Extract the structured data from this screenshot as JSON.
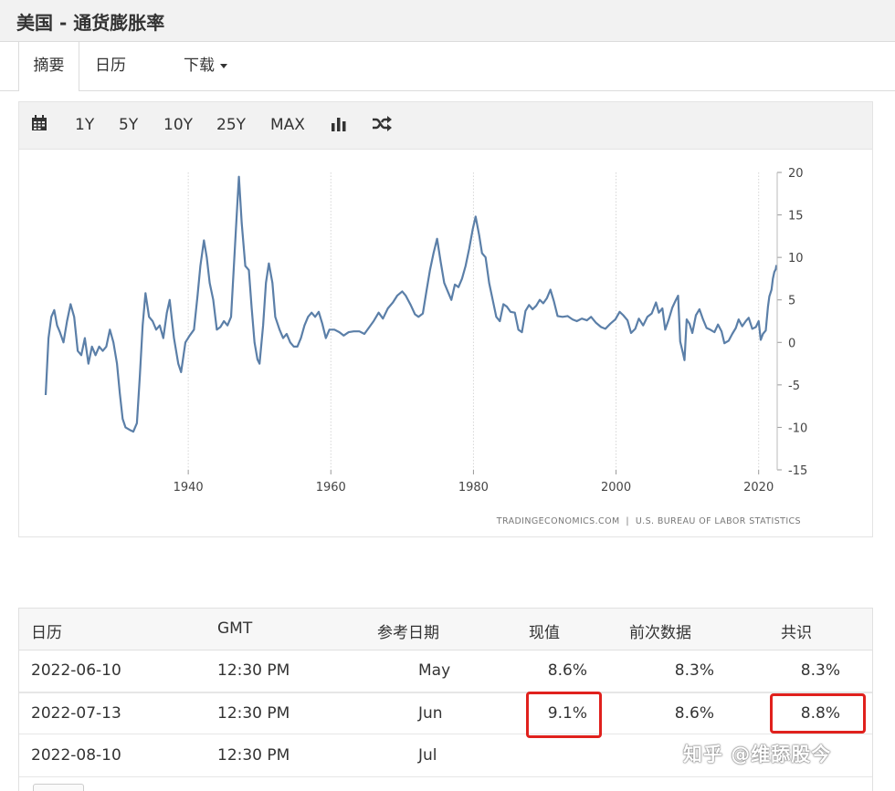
{
  "page": {
    "title": "美国 - 通货膨胀率"
  },
  "tabs": [
    {
      "label": "摘要",
      "active": true
    },
    {
      "label": "日历",
      "active": false
    },
    {
      "label": "下载",
      "active": false
    }
  ],
  "toolbar": {
    "icons": [
      "calendar-icon",
      "bar-chart-icon",
      "shuffle-icon"
    ],
    "ranges": [
      "1Y",
      "5Y",
      "10Y",
      "25Y",
      "MAX"
    ]
  },
  "chart": {
    "source": "TRADINGECONOMICS.COM  |  U.S. BUREAU OF LABOR STATISTICS",
    "line_color": "#5b7fa8"
  },
  "chart_data": {
    "type": "line",
    "title": "",
    "xlabel": "",
    "ylabel": "",
    "xlim": [
      1920,
      2022.6
    ],
    "ylim": [
      -15,
      20
    ],
    "xticks": [
      1940,
      1960,
      1980,
      2000,
      2020
    ],
    "yticks": [
      20,
      15,
      10,
      5,
      0,
      -5,
      -10,
      -15
    ],
    "grid": true,
    "series": [
      {
        "name": "",
        "points": [
          [
            1920.0,
            -6.2
          ],
          [
            1920.4,
            0.5
          ],
          [
            1920.8,
            3.0
          ],
          [
            1921.2,
            3.8
          ],
          [
            1921.6,
            2.0
          ],
          [
            1922.0,
            1.2
          ],
          [
            1922.5,
            0.0
          ],
          [
            1923.0,
            2.5
          ],
          [
            1923.5,
            4.5
          ],
          [
            1924.0,
            3.0
          ],
          [
            1924.5,
            -1.0
          ],
          [
            1925.0,
            -1.5
          ],
          [
            1925.5,
            0.5
          ],
          [
            1926.0,
            -2.5
          ],
          [
            1926.5,
            -0.5
          ],
          [
            1927.0,
            -1.5
          ],
          [
            1927.5,
            -0.5
          ],
          [
            1928.0,
            -1.0
          ],
          [
            1928.5,
            -0.5
          ],
          [
            1929.0,
            1.5
          ],
          [
            1929.5,
            0.0
          ],
          [
            1930.0,
            -2.5
          ],
          [
            1930.4,
            -6.0
          ],
          [
            1930.8,
            -9.0
          ],
          [
            1931.2,
            -10.0
          ],
          [
            1931.8,
            -10.3
          ],
          [
            1932.3,
            -10.5
          ],
          [
            1932.8,
            -9.5
          ],
          [
            1933.2,
            -4.0
          ],
          [
            1933.6,
            2.0
          ],
          [
            1934.0,
            5.8
          ],
          [
            1934.5,
            3.0
          ],
          [
            1935.0,
            2.5
          ],
          [
            1935.5,
            1.5
          ],
          [
            1936.0,
            2.0
          ],
          [
            1936.5,
            0.5
          ],
          [
            1937.0,
            3.5
          ],
          [
            1937.4,
            5.0
          ],
          [
            1938.0,
            0.5
          ],
          [
            1938.6,
            -2.5
          ],
          [
            1939.0,
            -3.5
          ],
          [
            1939.6,
            0.0
          ],
          [
            1940.2,
            0.8
          ],
          [
            1940.8,
            1.5
          ],
          [
            1941.3,
            5.5
          ],
          [
            1941.7,
            9.0
          ],
          [
            1942.2,
            12.0
          ],
          [
            1942.6,
            10.0
          ],
          [
            1943.0,
            7.0
          ],
          [
            1943.5,
            5.0
          ],
          [
            1944.0,
            1.5
          ],
          [
            1944.5,
            1.8
          ],
          [
            1945.0,
            2.5
          ],
          [
            1945.5,
            2.0
          ],
          [
            1946.0,
            3.0
          ],
          [
            1946.4,
            9.0
          ],
          [
            1946.8,
            15.0
          ],
          [
            1947.1,
            19.5
          ],
          [
            1947.5,
            14.0
          ],
          [
            1948.0,
            9.0
          ],
          [
            1948.5,
            8.5
          ],
          [
            1948.9,
            4.0
          ],
          [
            1949.3,
            0.0
          ],
          [
            1949.7,
            -2.0
          ],
          [
            1950.0,
            -2.5
          ],
          [
            1950.5,
            2.0
          ],
          [
            1950.9,
            7.0
          ],
          [
            1951.3,
            9.3
          ],
          [
            1951.8,
            7.0
          ],
          [
            1952.2,
            3.0
          ],
          [
            1952.8,
            1.5
          ],
          [
            1953.3,
            0.5
          ],
          [
            1953.8,
            1.0
          ],
          [
            1954.3,
            0.0
          ],
          [
            1954.8,
            -0.5
          ],
          [
            1955.3,
            -0.5
          ],
          [
            1955.8,
            0.5
          ],
          [
            1956.3,
            2.0
          ],
          [
            1956.8,
            3.0
          ],
          [
            1957.3,
            3.5
          ],
          [
            1957.8,
            3.0
          ],
          [
            1958.3,
            3.6
          ],
          [
            1958.8,
            2.2
          ],
          [
            1959.3,
            0.5
          ],
          [
            1959.8,
            1.5
          ],
          [
            1960.5,
            1.5
          ],
          [
            1961.2,
            1.2
          ],
          [
            1961.8,
            0.8
          ],
          [
            1962.5,
            1.2
          ],
          [
            1963.2,
            1.3
          ],
          [
            1964.0,
            1.3
          ],
          [
            1964.7,
            1.0
          ],
          [
            1965.3,
            1.7
          ],
          [
            1966.0,
            2.5
          ],
          [
            1966.7,
            3.5
          ],
          [
            1967.3,
            2.8
          ],
          [
            1968.0,
            4.0
          ],
          [
            1968.7,
            4.7
          ],
          [
            1969.3,
            5.5
          ],
          [
            1970.0,
            6.0
          ],
          [
            1970.5,
            5.5
          ],
          [
            1971.2,
            4.4
          ],
          [
            1971.8,
            3.3
          ],
          [
            1972.3,
            3.0
          ],
          [
            1972.9,
            3.4
          ],
          [
            1973.4,
            6.0
          ],
          [
            1973.9,
            8.5
          ],
          [
            1974.4,
            10.5
          ],
          [
            1974.9,
            12.2
          ],
          [
            1975.4,
            9.5
          ],
          [
            1975.9,
            7.0
          ],
          [
            1976.4,
            6.0
          ],
          [
            1976.9,
            5.0
          ],
          [
            1977.4,
            6.8
          ],
          [
            1977.9,
            6.5
          ],
          [
            1978.4,
            7.5
          ],
          [
            1978.9,
            9.0
          ],
          [
            1979.4,
            11.0
          ],
          [
            1979.9,
            13.3
          ],
          [
            1980.3,
            14.8
          ],
          [
            1980.8,
            12.6
          ],
          [
            1981.2,
            10.5
          ],
          [
            1981.7,
            10.0
          ],
          [
            1982.2,
            7.0
          ],
          [
            1982.7,
            5.0
          ],
          [
            1983.2,
            3.0
          ],
          [
            1983.7,
            2.5
          ],
          [
            1984.2,
            4.5
          ],
          [
            1984.7,
            4.2
          ],
          [
            1985.2,
            3.6
          ],
          [
            1985.8,
            3.5
          ],
          [
            1986.3,
            1.5
          ],
          [
            1986.8,
            1.2
          ],
          [
            1987.3,
            3.7
          ],
          [
            1987.8,
            4.4
          ],
          [
            1988.3,
            3.9
          ],
          [
            1988.8,
            4.3
          ],
          [
            1989.3,
            5.0
          ],
          [
            1989.8,
            4.6
          ],
          [
            1990.3,
            5.2
          ],
          [
            1990.8,
            6.2
          ],
          [
            1991.3,
            4.8
          ],
          [
            1991.8,
            3.1
          ],
          [
            1992.5,
            3.0
          ],
          [
            1993.2,
            3.1
          ],
          [
            1993.9,
            2.7
          ],
          [
            1994.5,
            2.5
          ],
          [
            1995.2,
            2.8
          ],
          [
            1995.9,
            2.6
          ],
          [
            1996.5,
            3.0
          ],
          [
            1997.2,
            2.3
          ],
          [
            1997.9,
            1.8
          ],
          [
            1998.5,
            1.6
          ],
          [
            1999.2,
            2.2
          ],
          [
            1999.9,
            2.7
          ],
          [
            2000.5,
            3.6
          ],
          [
            2001.0,
            3.2
          ],
          [
            2001.6,
            2.6
          ],
          [
            2002.1,
            1.1
          ],
          [
            2002.7,
            1.6
          ],
          [
            2003.2,
            2.8
          ],
          [
            2003.8,
            2.0
          ],
          [
            2004.4,
            3.0
          ],
          [
            2005.0,
            3.4
          ],
          [
            2005.6,
            4.7
          ],
          [
            2006.0,
            3.5
          ],
          [
            2006.5,
            4.0
          ],
          [
            2006.9,
            1.5
          ],
          [
            2007.4,
            2.7
          ],
          [
            2007.9,
            4.1
          ],
          [
            2008.4,
            5.0
          ],
          [
            2008.7,
            5.5
          ],
          [
            2009.0,
            0.1
          ],
          [
            2009.4,
            -1.3
          ],
          [
            2009.6,
            -2.1
          ],
          [
            2009.9,
            2.7
          ],
          [
            2010.3,
            2.2
          ],
          [
            2010.7,
            1.1
          ],
          [
            2011.2,
            3.2
          ],
          [
            2011.7,
            3.9
          ],
          [
            2012.2,
            2.7
          ],
          [
            2012.7,
            1.7
          ],
          [
            2013.2,
            1.5
          ],
          [
            2013.8,
            1.2
          ],
          [
            2014.3,
            2.1
          ],
          [
            2014.8,
            1.3
          ],
          [
            2015.2,
            -0.1
          ],
          [
            2015.8,
            0.2
          ],
          [
            2016.3,
            1.0
          ],
          [
            2016.8,
            1.7
          ],
          [
            2017.2,
            2.7
          ],
          [
            2017.7,
            1.9
          ],
          [
            2018.2,
            2.5
          ],
          [
            2018.6,
            2.9
          ],
          [
            2019.1,
            1.6
          ],
          [
            2019.6,
            1.8
          ],
          [
            2020.0,
            2.5
          ],
          [
            2020.3,
            0.3
          ],
          [
            2020.6,
            1.0
          ],
          [
            2021.0,
            1.4
          ],
          [
            2021.3,
            4.2
          ],
          [
            2021.5,
            5.4
          ],
          [
            2021.8,
            6.2
          ],
          [
            2022.0,
            7.5
          ],
          [
            2022.2,
            8.3
          ],
          [
            2022.4,
            8.6
          ],
          [
            2022.5,
            9.1
          ]
        ]
      }
    ]
  },
  "table": {
    "headers": [
      "日历",
      "GMT",
      "参考日期",
      "现值",
      "前次数据",
      "共识"
    ],
    "rows": [
      {
        "date": "2022-06-10",
        "time": "12:30 PM",
        "ref": "May",
        "actual": "8.6%",
        "previous": "8.3%",
        "consensus": "8.3%"
      },
      {
        "date": "2022-07-13",
        "time": "12:30 PM",
        "ref": "Jun",
        "actual": "9.1%",
        "previous": "8.6%",
        "consensus": "8.8%"
      },
      {
        "date": "2022-08-10",
        "time": "12:30 PM",
        "ref": "Jul",
        "actual": "",
        "previous": "",
        "consensus": ""
      }
    ],
    "highlight_color": "#e0211d"
  },
  "watermark": "知乎 @维舔股今"
}
